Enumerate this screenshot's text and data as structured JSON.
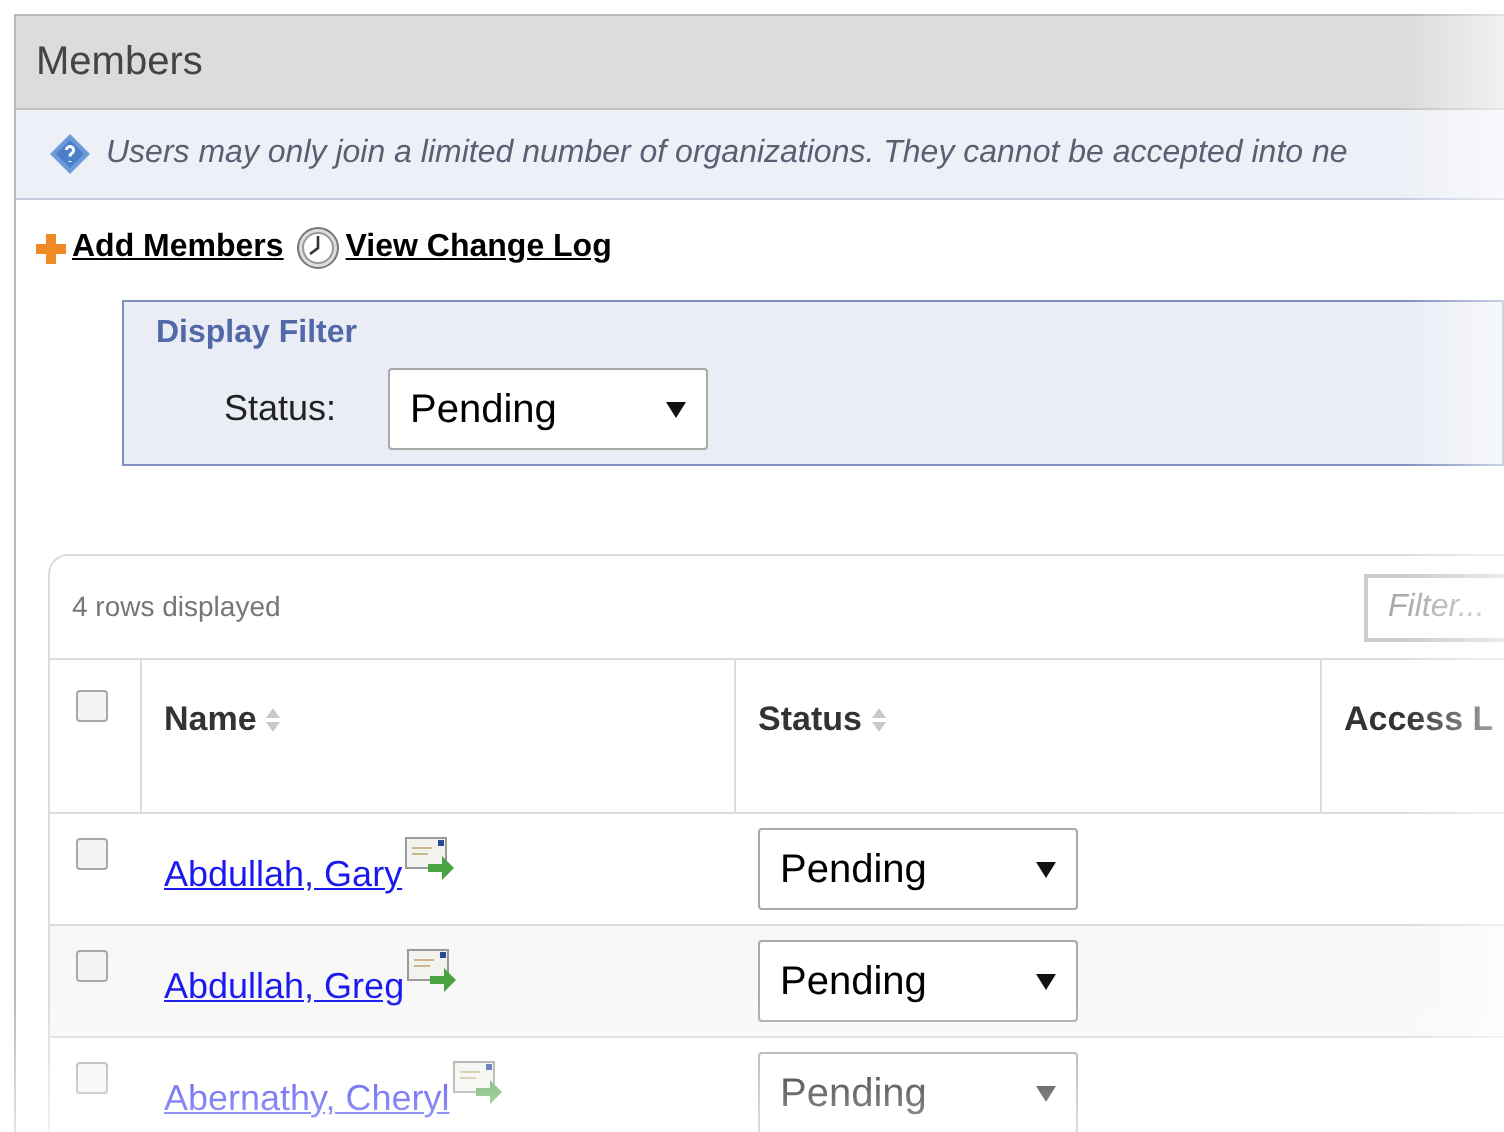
{
  "panel": {
    "title": "Members"
  },
  "notice": "Users may only join a limited number of organizations. They cannot be accepted into ne",
  "actions": [
    {
      "kind": "add",
      "label": "Add Members"
    },
    {
      "kind": "log",
      "label": "View Change Log"
    }
  ],
  "display_filter": {
    "title": "Display Filter",
    "label": "Status:",
    "value": "Pending"
  },
  "table": {
    "row_count": "4 rows displayed",
    "filter": {
      "placeholder": "Filter..."
    },
    "header_checked": false,
    "columns": [
      {
        "label": "Name",
        "sortable": true
      },
      {
        "label": "Status",
        "sortable": true
      },
      {
        "label": "Access L",
        "sortable": false
      }
    ],
    "rows": [
      {
        "name": "Abdullah, Gary",
        "status": "Pending",
        "checked": false
      },
      {
        "name": "Abdullah, Greg",
        "status": "Pending",
        "checked": false
      },
      {
        "name": "Abernathy, Cheryl",
        "status": "Pending",
        "checked": false
      }
    ]
  }
}
